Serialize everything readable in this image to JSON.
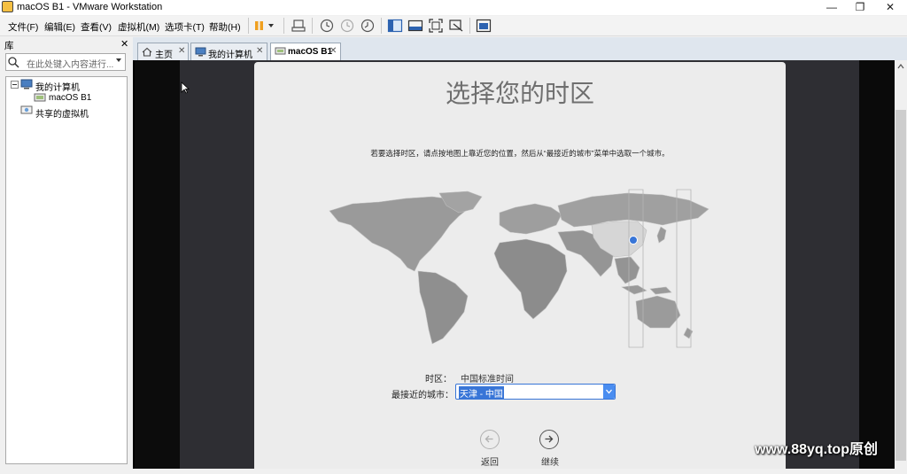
{
  "window": {
    "title": "macOS B1 - VMware Workstation",
    "controls": {
      "minimize": "—",
      "maximize": "❐",
      "close": "✕"
    }
  },
  "menu": [
    "文件(F)",
    "编辑(E)",
    "查看(V)",
    "虚拟机(M)",
    "选项卡(T)",
    "帮助(H)"
  ],
  "library": {
    "title": "库",
    "close": "✕",
    "search_placeholder": "在此处键入内容进行...",
    "tree": {
      "my_computer": "我的计算机",
      "vm": "macOS B1",
      "shared": "共享的虚拟机"
    }
  },
  "tabs": [
    {
      "label": "主页",
      "close": "✕"
    },
    {
      "label": "我的计算机",
      "close": "✕"
    },
    {
      "label": "macOS B1",
      "close": "✕",
      "active": true
    }
  ],
  "installer": {
    "title": "选择您的时区",
    "subtitle": "若要选择时区，请点按地图上靠近您的位置，然后从“最接近的城市”菜单中选取一个城市。",
    "timezone_label": "时区：",
    "timezone_value": "中国标准时间",
    "city_label": "最接近的城市：",
    "city_value": "天津 - 中国",
    "back_label": "返回",
    "continue_label": "继续"
  },
  "watermark": "www.88yq.top原创",
  "colors": {
    "accent": "#3875d7",
    "highlight_region": "#3875d7"
  }
}
